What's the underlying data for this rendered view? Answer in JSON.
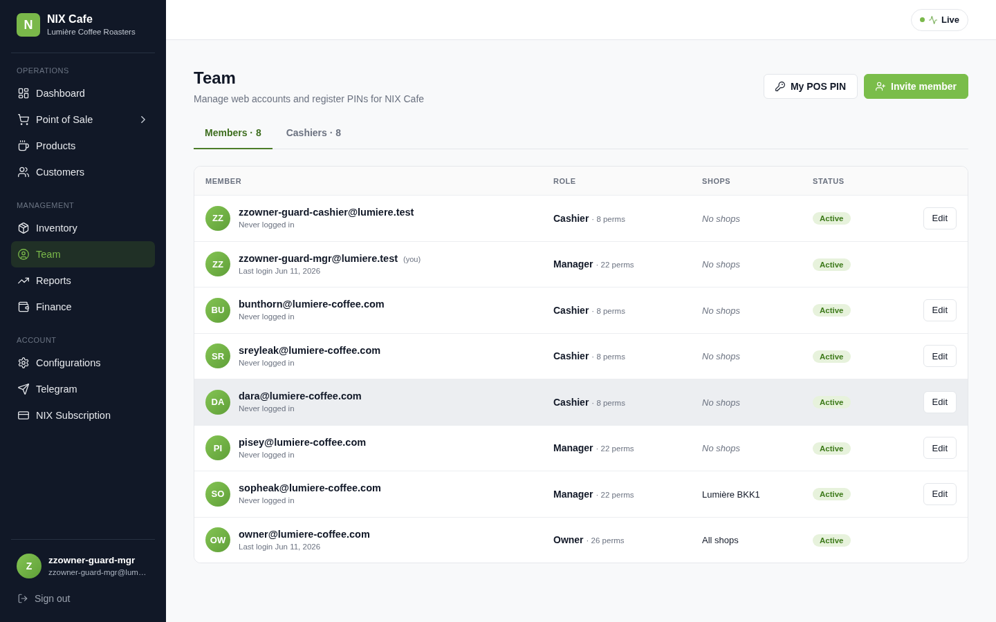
{
  "sidebar": {
    "brand": {
      "logo": "N",
      "name": "NIX Cafe",
      "subtitle": "Lumière Coffee Roasters"
    },
    "sections": [
      {
        "title": "OPERATIONS",
        "items": [
          {
            "label": "Dashboard",
            "selected": false,
            "submenu": false
          },
          {
            "label": "Point of Sale",
            "selected": false,
            "submenu": true
          },
          {
            "label": "Products",
            "selected": false,
            "submenu": false
          },
          {
            "label": "Customers",
            "selected": false,
            "submenu": false
          }
        ]
      },
      {
        "title": "MANAGEMENT",
        "items": [
          {
            "label": "Inventory",
            "selected": false,
            "submenu": false
          },
          {
            "label": "Team",
            "selected": true,
            "submenu": false
          },
          {
            "label": "Reports",
            "selected": false,
            "submenu": false
          },
          {
            "label": "Finance",
            "selected": false,
            "submenu": false
          }
        ]
      },
      {
        "title": "ACCOUNT",
        "items": [
          {
            "label": "Configurations",
            "selected": false,
            "submenu": false
          },
          {
            "label": "Telegram",
            "selected": false,
            "submenu": false
          },
          {
            "label": "NIX Subscription",
            "selected": false,
            "submenu": false
          }
        ]
      }
    ],
    "user": {
      "avatar": "Z",
      "name": "zzowner-guard-mgr",
      "email": "zzowner-guard-mgr@lum…"
    },
    "sign_out": "Sign out"
  },
  "top_bar": {
    "status": {
      "label": "Live",
      "on": true
    }
  },
  "page": {
    "title": "Team",
    "subtitle": "Manage web accounts and register PINs for NIX Cafe",
    "buttons": [
      {
        "label": "My POS PIN",
        "kind": "secondary"
      },
      {
        "label": "Invite member",
        "kind": "primary"
      }
    ]
  },
  "tabs": [
    {
      "label": "Members · 8",
      "selected": true
    },
    {
      "label": "Cashiers · 8",
      "selected": false
    }
  ],
  "table": {
    "columns": [
      "MEMBER",
      "ROLE",
      "SHOPS",
      "STATUS"
    ],
    "rows": [
      {
        "initials": "ZZ",
        "email": "zzowner-guard-cashier@lumiere.test",
        "last_login": "Never logged in",
        "role": "Cashier",
        "perms": "· 8 perms",
        "shops": "No shops",
        "shops_empty": true,
        "status": "Active",
        "action": "Edit",
        "hovered": false
      },
      {
        "initials": "ZZ",
        "email": "zzowner-guard-mgr@lumiere.test",
        "tag": "(you)",
        "last_login": "Last login Jun 11, 2026",
        "role": "Manager",
        "perms": "· 22 perms",
        "shops": "No shops",
        "shops_empty": true,
        "status": "Active",
        "hovered": false
      },
      {
        "initials": "BU",
        "email": "bunthorn@lumiere-coffee.com",
        "last_login": "Never logged in",
        "role": "Cashier",
        "perms": "· 8 perms",
        "shops": "No shops",
        "shops_empty": true,
        "status": "Active",
        "action": "Edit",
        "hovered": false
      },
      {
        "initials": "SR",
        "email": "sreyleak@lumiere-coffee.com",
        "last_login": "Never logged in",
        "role": "Cashier",
        "perms": "· 8 perms",
        "shops": "No shops",
        "shops_empty": true,
        "status": "Active",
        "action": "Edit",
        "hovered": false
      },
      {
        "initials": "DA",
        "email": "dara@lumiere-coffee.com",
        "last_login": "Never logged in",
        "role": "Cashier",
        "perms": "· 8 perms",
        "shops": "No shops",
        "shops_empty": true,
        "status": "Active",
        "action": "Edit",
        "hovered": true
      },
      {
        "initials": "PI",
        "email": "pisey@lumiere-coffee.com",
        "last_login": "Never logged in",
        "role": "Manager",
        "perms": "· 22 perms",
        "shops": "No shops",
        "shops_empty": true,
        "status": "Active",
        "action": "Edit",
        "hovered": false
      },
      {
        "initials": "SO",
        "email": "sopheak@lumiere-coffee.com",
        "last_login": "Never logged in",
        "role": "Manager",
        "perms": "· 22 perms",
        "shops": "Lumière BKK1",
        "shops_empty": false,
        "status": "Active",
        "action": "Edit",
        "hovered": false
      },
      {
        "initials": "OW",
        "email": "owner@lumiere-coffee.com",
        "last_login": "Last login Jun 11, 2026",
        "role": "Owner",
        "perms": "· 26 perms",
        "shops": "All shops",
        "shops_empty": false,
        "status": "Active",
        "hovered": false
      }
    ]
  }
}
